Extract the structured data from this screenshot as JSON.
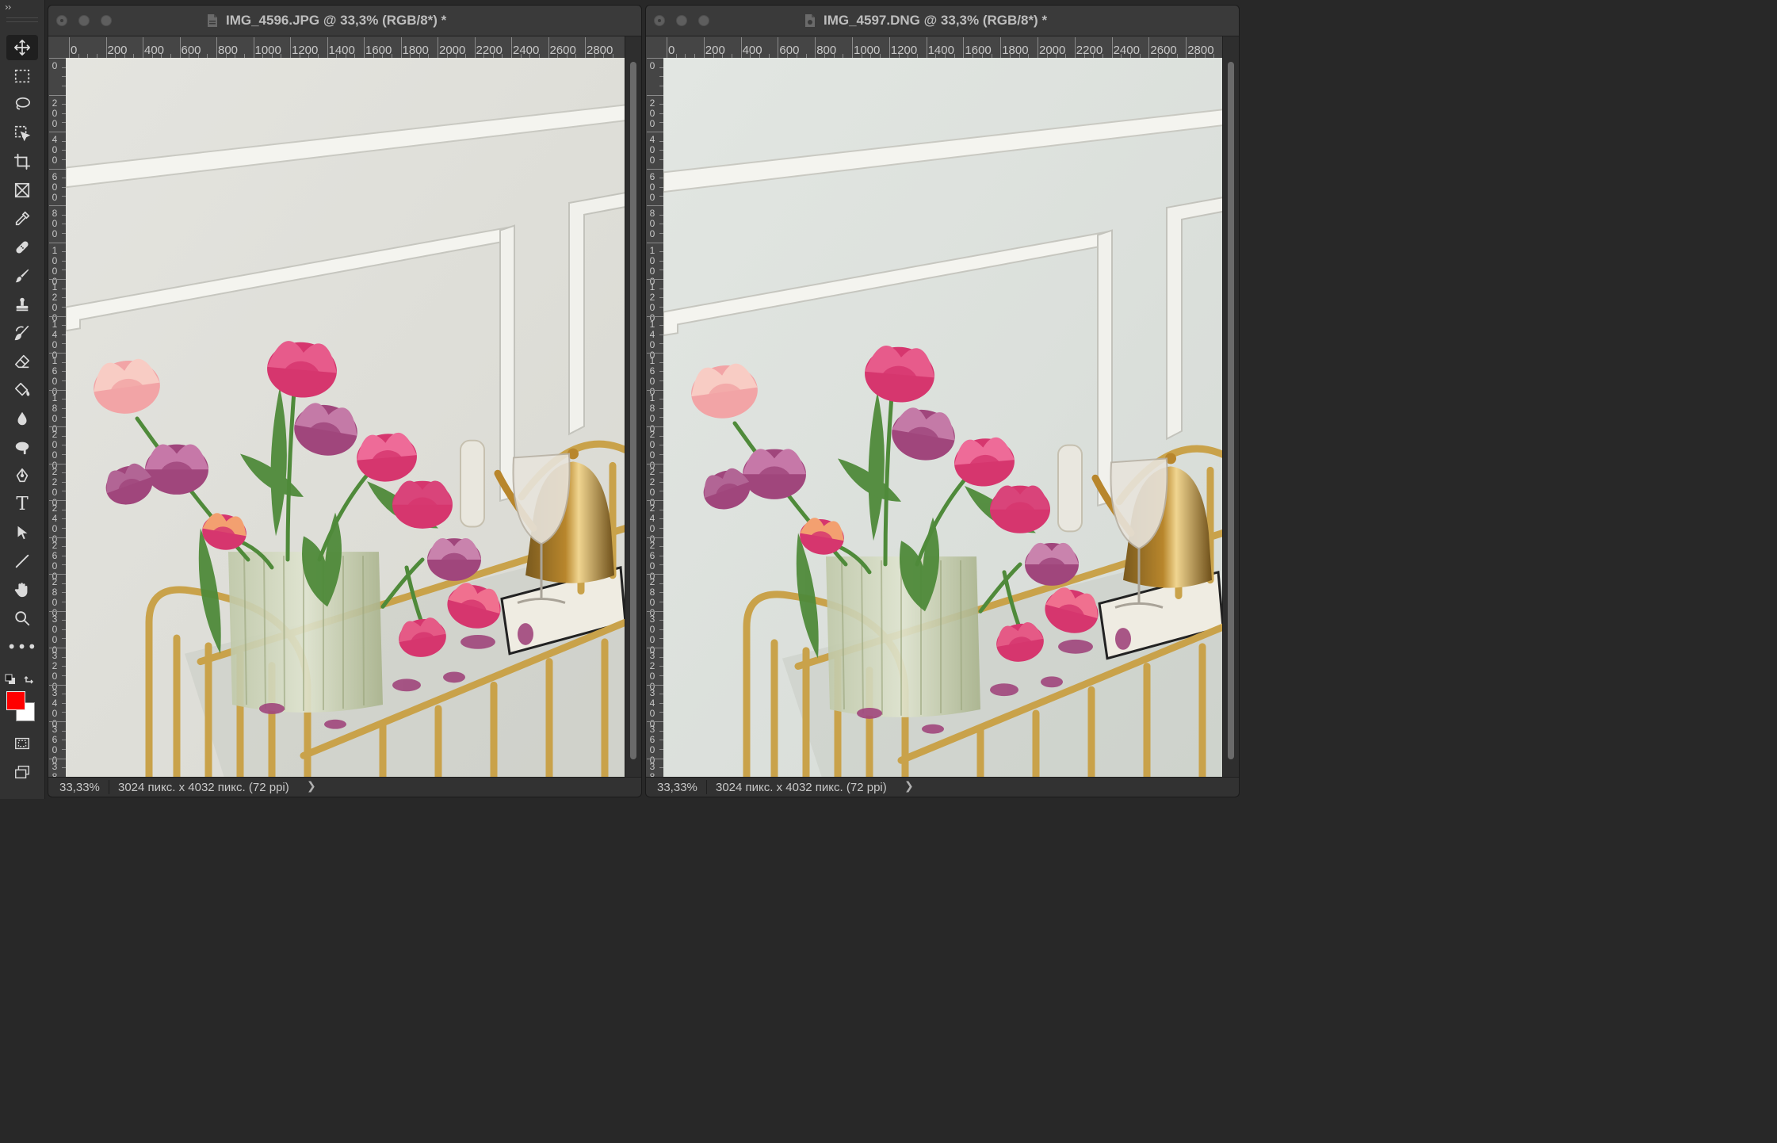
{
  "toolbar": {
    "expand_label": "››",
    "tools": [
      {
        "name": "move-tool",
        "icon": "move-icon",
        "active": true
      },
      {
        "name": "rectangular-marquee-tool",
        "icon": "marquee-icon"
      },
      {
        "name": "lasso-tool",
        "icon": "lasso-icon"
      },
      {
        "name": "object-selection-tool",
        "icon": "object-selection-icon"
      },
      {
        "name": "crop-tool",
        "icon": "crop-icon"
      },
      {
        "name": "frame-tool",
        "icon": "frame-icon"
      },
      {
        "name": "eyedropper-tool",
        "icon": "eyedropper-icon"
      },
      {
        "name": "healing-brush-tool",
        "icon": "bandage-icon"
      },
      {
        "name": "brush-tool",
        "icon": "brush-icon"
      },
      {
        "name": "clone-stamp-tool",
        "icon": "stamp-icon"
      },
      {
        "name": "history-brush-tool",
        "icon": "history-brush-icon"
      },
      {
        "name": "eraser-tool",
        "icon": "eraser-icon"
      },
      {
        "name": "paint-bucket-tool",
        "icon": "bucket-icon"
      },
      {
        "name": "blur-tool",
        "icon": "drop-icon"
      },
      {
        "name": "dodge-tool",
        "icon": "dodge-icon"
      },
      {
        "name": "pen-tool",
        "icon": "pen-icon"
      },
      {
        "name": "type-tool",
        "icon": "type-icon",
        "glyph": "T"
      },
      {
        "name": "path-selection-tool",
        "icon": "arrow-cursor-icon"
      },
      {
        "name": "line-tool",
        "icon": "line-icon"
      },
      {
        "name": "hand-tool",
        "icon": "hand-icon"
      },
      {
        "name": "zoom-tool",
        "icon": "zoom-icon"
      },
      {
        "name": "edit-toolbar",
        "icon": "more-dots-icon",
        "glyph": "•••"
      }
    ],
    "foreground_color": "#ff0000",
    "background_color": "#ffffff",
    "bottom_tools": [
      {
        "name": "quick-mask-button",
        "icon": "quick-mask-icon"
      },
      {
        "name": "screen-mode-button",
        "icon": "screen-mode-icon"
      }
    ]
  },
  "documents": [
    {
      "title": "IMG_4596.JPG @ 33,3% (RGB/8*) *",
      "file_icon": "jpg-file-icon",
      "zoom": "33,33%",
      "info": "3024 пикс. x 4032 пикс. (72 ppi)",
      "ruler_top": [
        "0",
        "200",
        "400",
        "600",
        "800",
        "1000",
        "1200",
        "1400",
        "1600",
        "1800",
        "2000",
        "2200",
        "2400",
        "2600",
        "2800"
      ],
      "ruler_left": [
        "0",
        "200",
        "400",
        "600",
        "800",
        "1000",
        "1200",
        "1400",
        "1600",
        "1800",
        "2000",
        "2200",
        "2400",
        "2600",
        "2800",
        "3000",
        "3200",
        "3400",
        "3600",
        "3800"
      ]
    },
    {
      "title": "IMG_4597.DNG @ 33,3% (RGB/8*) *",
      "file_icon": "dng-file-icon",
      "zoom": "33,33%",
      "info": "3024 пикс. x 4032 пикс. (72 ppi)",
      "ruler_top": [
        "0",
        "200",
        "400",
        "600",
        "800",
        "1000",
        "1200",
        "1400",
        "1600",
        "1800",
        "2000",
        "2200",
        "2400",
        "2600",
        "2800"
      ],
      "ruler_left": [
        "0",
        "200",
        "400",
        "600",
        "800",
        "1000",
        "1200",
        "1400",
        "1600",
        "1800",
        "2000",
        "2200",
        "2400",
        "2600",
        "2800",
        "3000",
        "3200",
        "3400",
        "3600",
        "3800"
      ]
    }
  ],
  "colors": {
    "app_bg": "#282828",
    "panel": "#323232",
    "titlebar": "#3a3a3a",
    "ruler": "#454545",
    "wall_left": "#e4e4df",
    "wall_right": "#e2e6e2",
    "tulip_pink": "#d6366e",
    "tulip_light": "#f2a4a6",
    "tulip_purple": "#a0467c",
    "leaf_green": "#4f8a3a",
    "brass": "#c9a24a",
    "kettle_gold": "#b8862c"
  }
}
